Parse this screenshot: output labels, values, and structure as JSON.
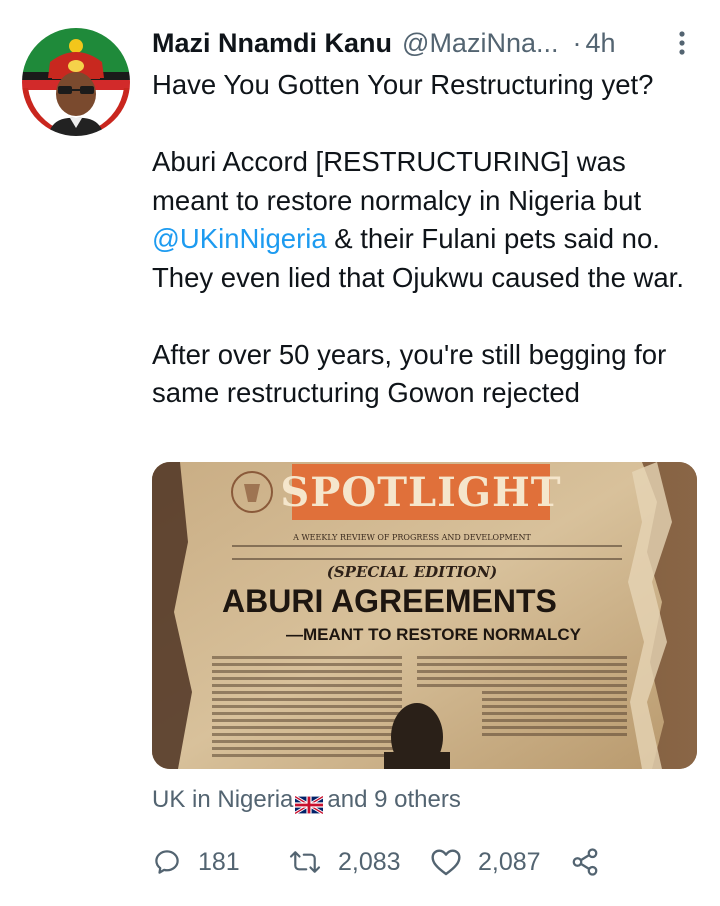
{
  "tweet": {
    "author_name": "Mazi Nnamdi Kanu",
    "handle": "@MaziNna...",
    "separator": "·",
    "time": "4h",
    "text": {
      "line1": "Have You Gotten Your Restructuring yet?",
      "p2_part1": "Aburi Accord [RESTRUCTURING] was meant to restore normalcy in Nigeria but ",
      "mention": "@UKinNigeria",
      "p2_part2": " & their Fulani pets said no. They even lied that Ojukwu caused the war.",
      "p3": "After over 50 years, you're still begging for same restructuring Gowon rejected"
    },
    "media": {
      "masthead": "SPOTLIGHT",
      "subhead": "A WEEKLY REVIEW OF PROGRESS AND DEVELOPMENT",
      "edition": "(SPECIAL EDITION)",
      "headline": "ABURI AGREEMENTS",
      "subheadline": "—MEANT TO RESTORE NORMALCY"
    },
    "social_context": {
      "prefix": "UK in Nigeria",
      "suffix": " and 9 others"
    },
    "actions": {
      "replies": "181",
      "retweets": "2,083",
      "likes": "2,087"
    }
  },
  "colors": {
    "link": "#1d9bf0",
    "secondary": "#536471",
    "text": "#0f1419"
  },
  "icons": [
    "more-vertical-icon",
    "reply-icon",
    "retweet-icon",
    "like-icon",
    "share-icon",
    "uk-flag-icon"
  ]
}
